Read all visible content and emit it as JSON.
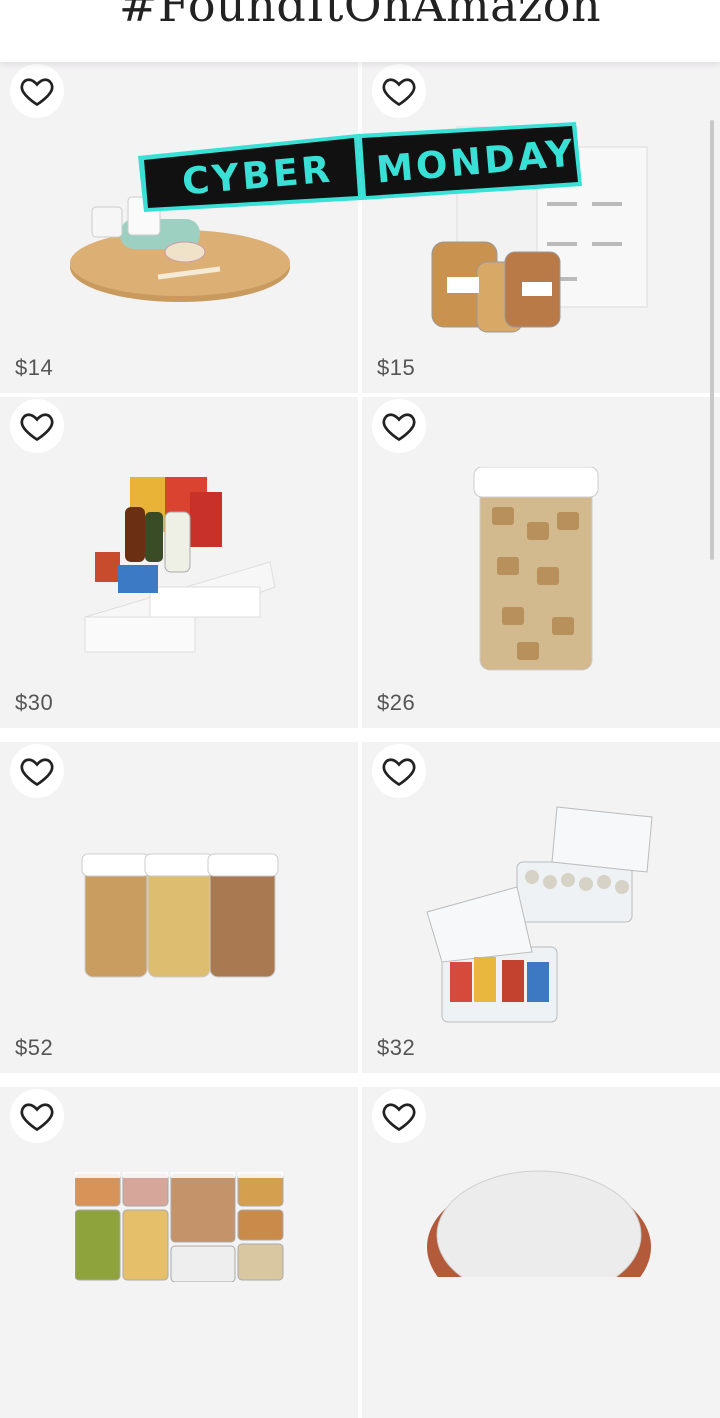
{
  "header": {
    "title": "#FoundItOnAmazon"
  },
  "promo": {
    "word1": "CYBER",
    "word2": "MONDAY"
  },
  "products": [
    {
      "price": "$14",
      "image": "lazy-susan-turntable",
      "favorite": false
    },
    {
      "price": "$15",
      "image": "pantry-label-jars",
      "favorite": false
    },
    {
      "price": "$30",
      "image": "tiered-spice-shelf",
      "favorite": false
    },
    {
      "price": "$26",
      "image": "cereal-container",
      "favorite": false
    },
    {
      "price": "$52",
      "image": "cereal-container-set",
      "favorite": false
    },
    {
      "price": "$32",
      "image": "tea-bag-organizers",
      "favorite": false
    },
    {
      "price": "",
      "image": "food-storage-set",
      "favorite": false
    },
    {
      "price": "",
      "image": "round-lid-container",
      "favorite": false
    }
  ],
  "colors": {
    "background": "#f4f3f4",
    "promo_text": "#38e0d6",
    "promo_bg": "#111111"
  }
}
